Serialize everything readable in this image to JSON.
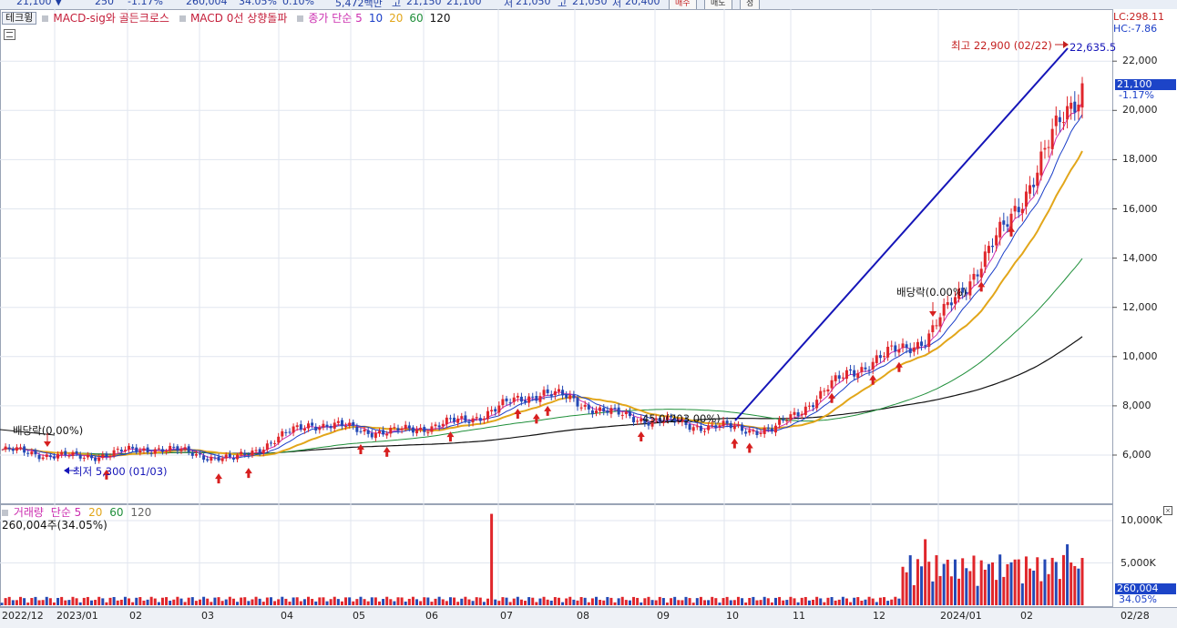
{
  "topbar": {
    "cells": [
      "21,100 ▼",
      "250",
      "-1.17%",
      "260,004",
      "34.05%",
      "0.10%",
      "5,472백만",
      "고",
      "21,150",
      "21,100",
      "저",
      "21,050",
      "고",
      "21,050",
      "저",
      "20,400"
    ],
    "buy_label": "매수",
    "sell_label": "매도",
    "misc_label": "정"
  },
  "legend": {
    "tab": "테크윙",
    "items": [
      {
        "text": "MACD-sig와 골든크로스",
        "color": "#c41e3a"
      },
      {
        "text": "MACD 0선 상향돌파",
        "color": "#c41e3a"
      },
      {
        "text": "종가 단순 5",
        "color": "#cc2fb0"
      },
      {
        "text": "10",
        "color": "#1a3ec8"
      },
      {
        "text": "20",
        "color": "#e2a61a"
      },
      {
        "text": "60",
        "color": "#1f8f3a"
      },
      {
        "text": "120",
        "color": "#111111"
      }
    ]
  },
  "right_axis": {
    "lc": "LC:298.11",
    "hc": "HC:-7.86",
    "current_price": "21,100",
    "current_change": "-1.17%",
    "volume_current": "260,004",
    "volume_pct": "34.05%"
  },
  "annotations": {
    "high": "최고 22,900 (02/22)",
    "trend_end": "22,635.5",
    "low": "최저 5,300 (01/03)",
    "dividend1": "배당락(0.00%)",
    "dividend2": "배당락(0.00%)",
    "mid_label": "45.0(203.00%)"
  },
  "volume_legend": {
    "title": "거래량",
    "ma_label": "단순 5",
    "ma": [
      "20",
      "60",
      "120"
    ],
    "value": "260,004주(34.05%)"
  },
  "colors": {
    "up": "#e0262b",
    "down": "#2449b5",
    "ma5": "#cc2fb0",
    "ma10": "#1a3ec8",
    "ma20": "#e2a61a",
    "ma60": "#1f8f3a",
    "ma120": "#111111",
    "trendline": "#1515b8",
    "grid": "#e1e6ef"
  },
  "chart_data": [
    {
      "type": "candlestick",
      "title": "테크윙",
      "ylim": [
        5000,
        23500
      ],
      "yticks": [
        6000,
        8000,
        10000,
        12000,
        14000,
        16000,
        18000,
        20000,
        22000
      ],
      "ytick_labels": [
        "6,000",
        "8,000",
        "10,000",
        "12,000",
        "14,000",
        "16,000",
        "18,000",
        "20,000",
        "22,000"
      ],
      "x_labels": [
        "2022/12",
        "2023/01",
        "02",
        "03",
        "04",
        "05",
        "06",
        "07",
        "08",
        "09",
        "10",
        "11",
        "12",
        "2024/01",
        "02",
        "02/28"
      ],
      "close_by_month": [
        {
          "month": "2022/12",
          "close": 6200
        },
        {
          "month": "2023/01",
          "close": 5900
        },
        {
          "month": "02",
          "close": 6300
        },
        {
          "month": "03",
          "close": 5800
        },
        {
          "month": "04",
          "close": 7300
        },
        {
          "month": "05",
          "close": 6900
        },
        {
          "month": "06",
          "close": 7400
        },
        {
          "month": "07",
          "close": 8600
        },
        {
          "month": "08",
          "close": 7600
        },
        {
          "month": "09",
          "close": 7200
        },
        {
          "month": "10",
          "close": 7000
        },
        {
          "month": "11",
          "close": 9400
        },
        {
          "month": "12",
          "close": 10800
        },
        {
          "month": "2024/01",
          "close": 15200
        },
        {
          "month": "02",
          "close": 21100
        }
      ],
      "ma_values_last": {
        "ma20": 18400,
        "ma60": 13900,
        "ma120": 11000
      }
    },
    {
      "type": "bar",
      "title": "거래량",
      "ylim": [
        0,
        11500
      ],
      "yticks": [
        5000,
        10000
      ],
      "ytick_labels": [
        "5,000K",
        "10,000K"
      ]
    }
  ]
}
